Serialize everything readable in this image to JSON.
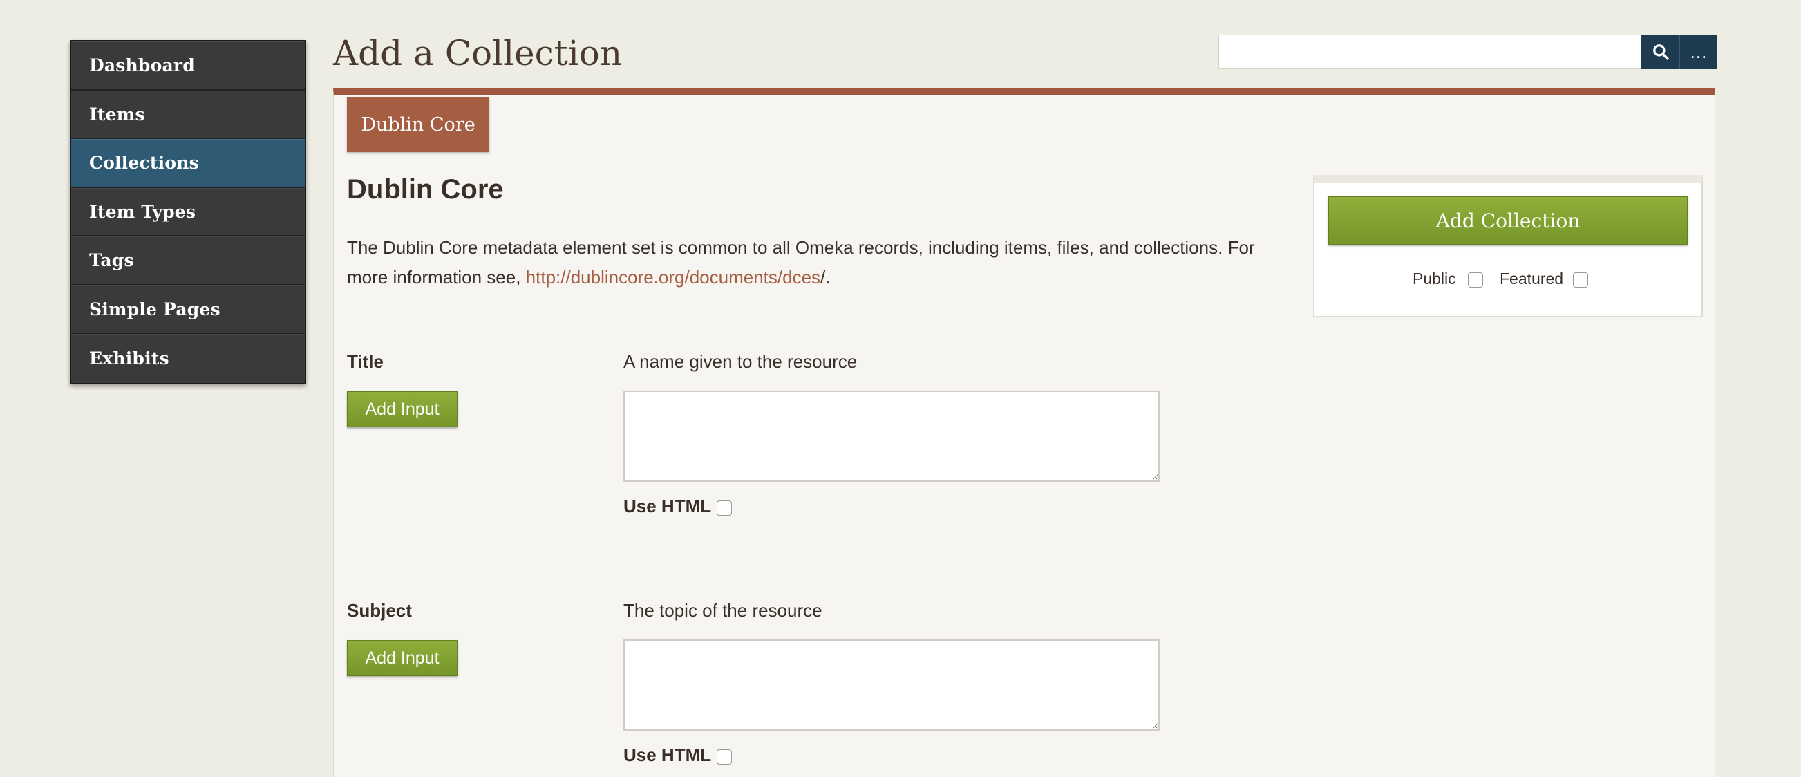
{
  "nav": {
    "items": [
      {
        "label": "Dashboard"
      },
      {
        "label": "Items"
      },
      {
        "label": "Collections",
        "active": true
      },
      {
        "label": "Item Types"
      },
      {
        "label": "Tags"
      },
      {
        "label": "Simple Pages"
      },
      {
        "label": "Exhibits"
      }
    ]
  },
  "header": {
    "title": "Add a Collection",
    "search": {
      "value": "",
      "placeholder": ""
    },
    "search_advanced_label": "..."
  },
  "tabs": [
    {
      "label": "Dublin Core"
    }
  ],
  "section": {
    "heading": "Dublin Core",
    "desc_prefix": "The Dublin Core metadata element set is common to all Omeka records, including items, files, and collections. For more information see, ",
    "desc_link": "http://dublincore.org/documents/dces",
    "desc_suffix": "/."
  },
  "save_panel": {
    "button_label": "Add Collection",
    "public_label": "Public",
    "featured_label": "Featured"
  },
  "fields": [
    {
      "label": "Title",
      "description": "A name given to the resource",
      "add_input_label": "Add Input",
      "use_html_label": "Use HTML"
    },
    {
      "label": "Subject",
      "description": "The topic of the resource",
      "add_input_label": "Add Input",
      "use_html_label": "Use HTML"
    }
  ],
  "colors": {
    "accent": "#a55e42",
    "nav_active": "#2f5a73",
    "button_green": "#82a232",
    "search_button": "#1f3b4f"
  },
  "icons": {
    "search": "search-icon"
  }
}
